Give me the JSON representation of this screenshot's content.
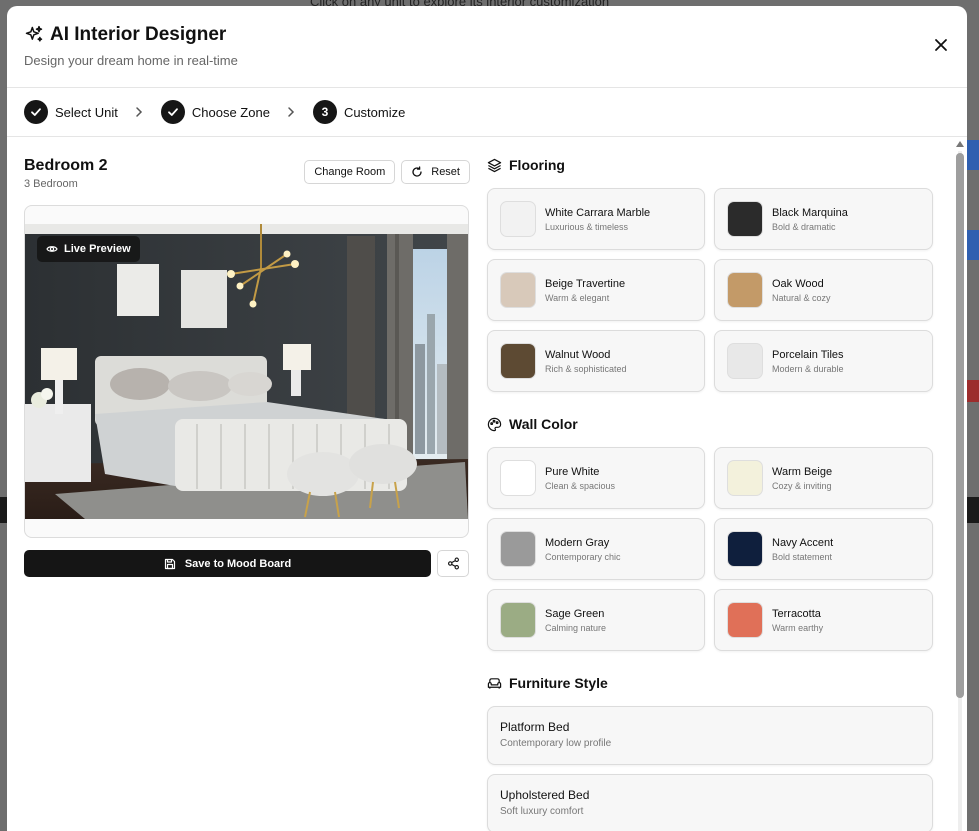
{
  "backdrop": {
    "text": "Click on any unit to explore its interior customization"
  },
  "header": {
    "title": "AI Interior Designer",
    "subtitle": "Design your dream home in real-time"
  },
  "steps": [
    {
      "label": "Select Unit",
      "status": "done"
    },
    {
      "label": "Choose Zone",
      "status": "done"
    },
    {
      "number": "3",
      "label": "Customize",
      "status": "current"
    }
  ],
  "room": {
    "name": "Bedroom 2",
    "type": "3 Bedroom",
    "change_label": "Change Room",
    "reset_label": "Reset",
    "preview_badge": "Live Preview",
    "save_label": "Save to Mood Board"
  },
  "flooring": {
    "title": "Flooring",
    "options": [
      {
        "name": "White Carrara Marble",
        "desc": "Luxurious & timeless",
        "color": "#f2f2f2"
      },
      {
        "name": "Black Marquina",
        "desc": "Bold & dramatic",
        "color": "#2b2b2b"
      },
      {
        "name": "Beige Travertine",
        "desc": "Warm & elegant",
        "color": "#d8c9ba"
      },
      {
        "name": "Oak Wood",
        "desc": "Natural & cozy",
        "color": "#c39a68"
      },
      {
        "name": "Walnut Wood",
        "desc": "Rich & sophisticated",
        "color": "#5d4a33"
      },
      {
        "name": "Porcelain Tiles",
        "desc": "Modern & durable",
        "color": "#e8e8e8"
      }
    ]
  },
  "wall_color": {
    "title": "Wall Color",
    "options": [
      {
        "name": "Pure White",
        "desc": "Clean & spacious",
        "color": "#ffffff"
      },
      {
        "name": "Warm Beige",
        "desc": "Cozy & inviting",
        "color": "#f3f1dc"
      },
      {
        "name": "Modern Gray",
        "desc": "Contemporary chic",
        "color": "#9a9a9a"
      },
      {
        "name": "Navy Accent",
        "desc": "Bold statement",
        "color": "#0f1f3d"
      },
      {
        "name": "Sage Green",
        "desc": "Calming nature",
        "color": "#9bac84"
      },
      {
        "name": "Terracotta",
        "desc": "Warm earthy",
        "color": "#e07058"
      }
    ]
  },
  "furniture": {
    "title": "Furniture Style",
    "options": [
      {
        "name": "Platform Bed",
        "desc": "Contemporary low profile"
      },
      {
        "name": "Upholstered Bed",
        "desc": "Soft luxury comfort"
      }
    ]
  }
}
